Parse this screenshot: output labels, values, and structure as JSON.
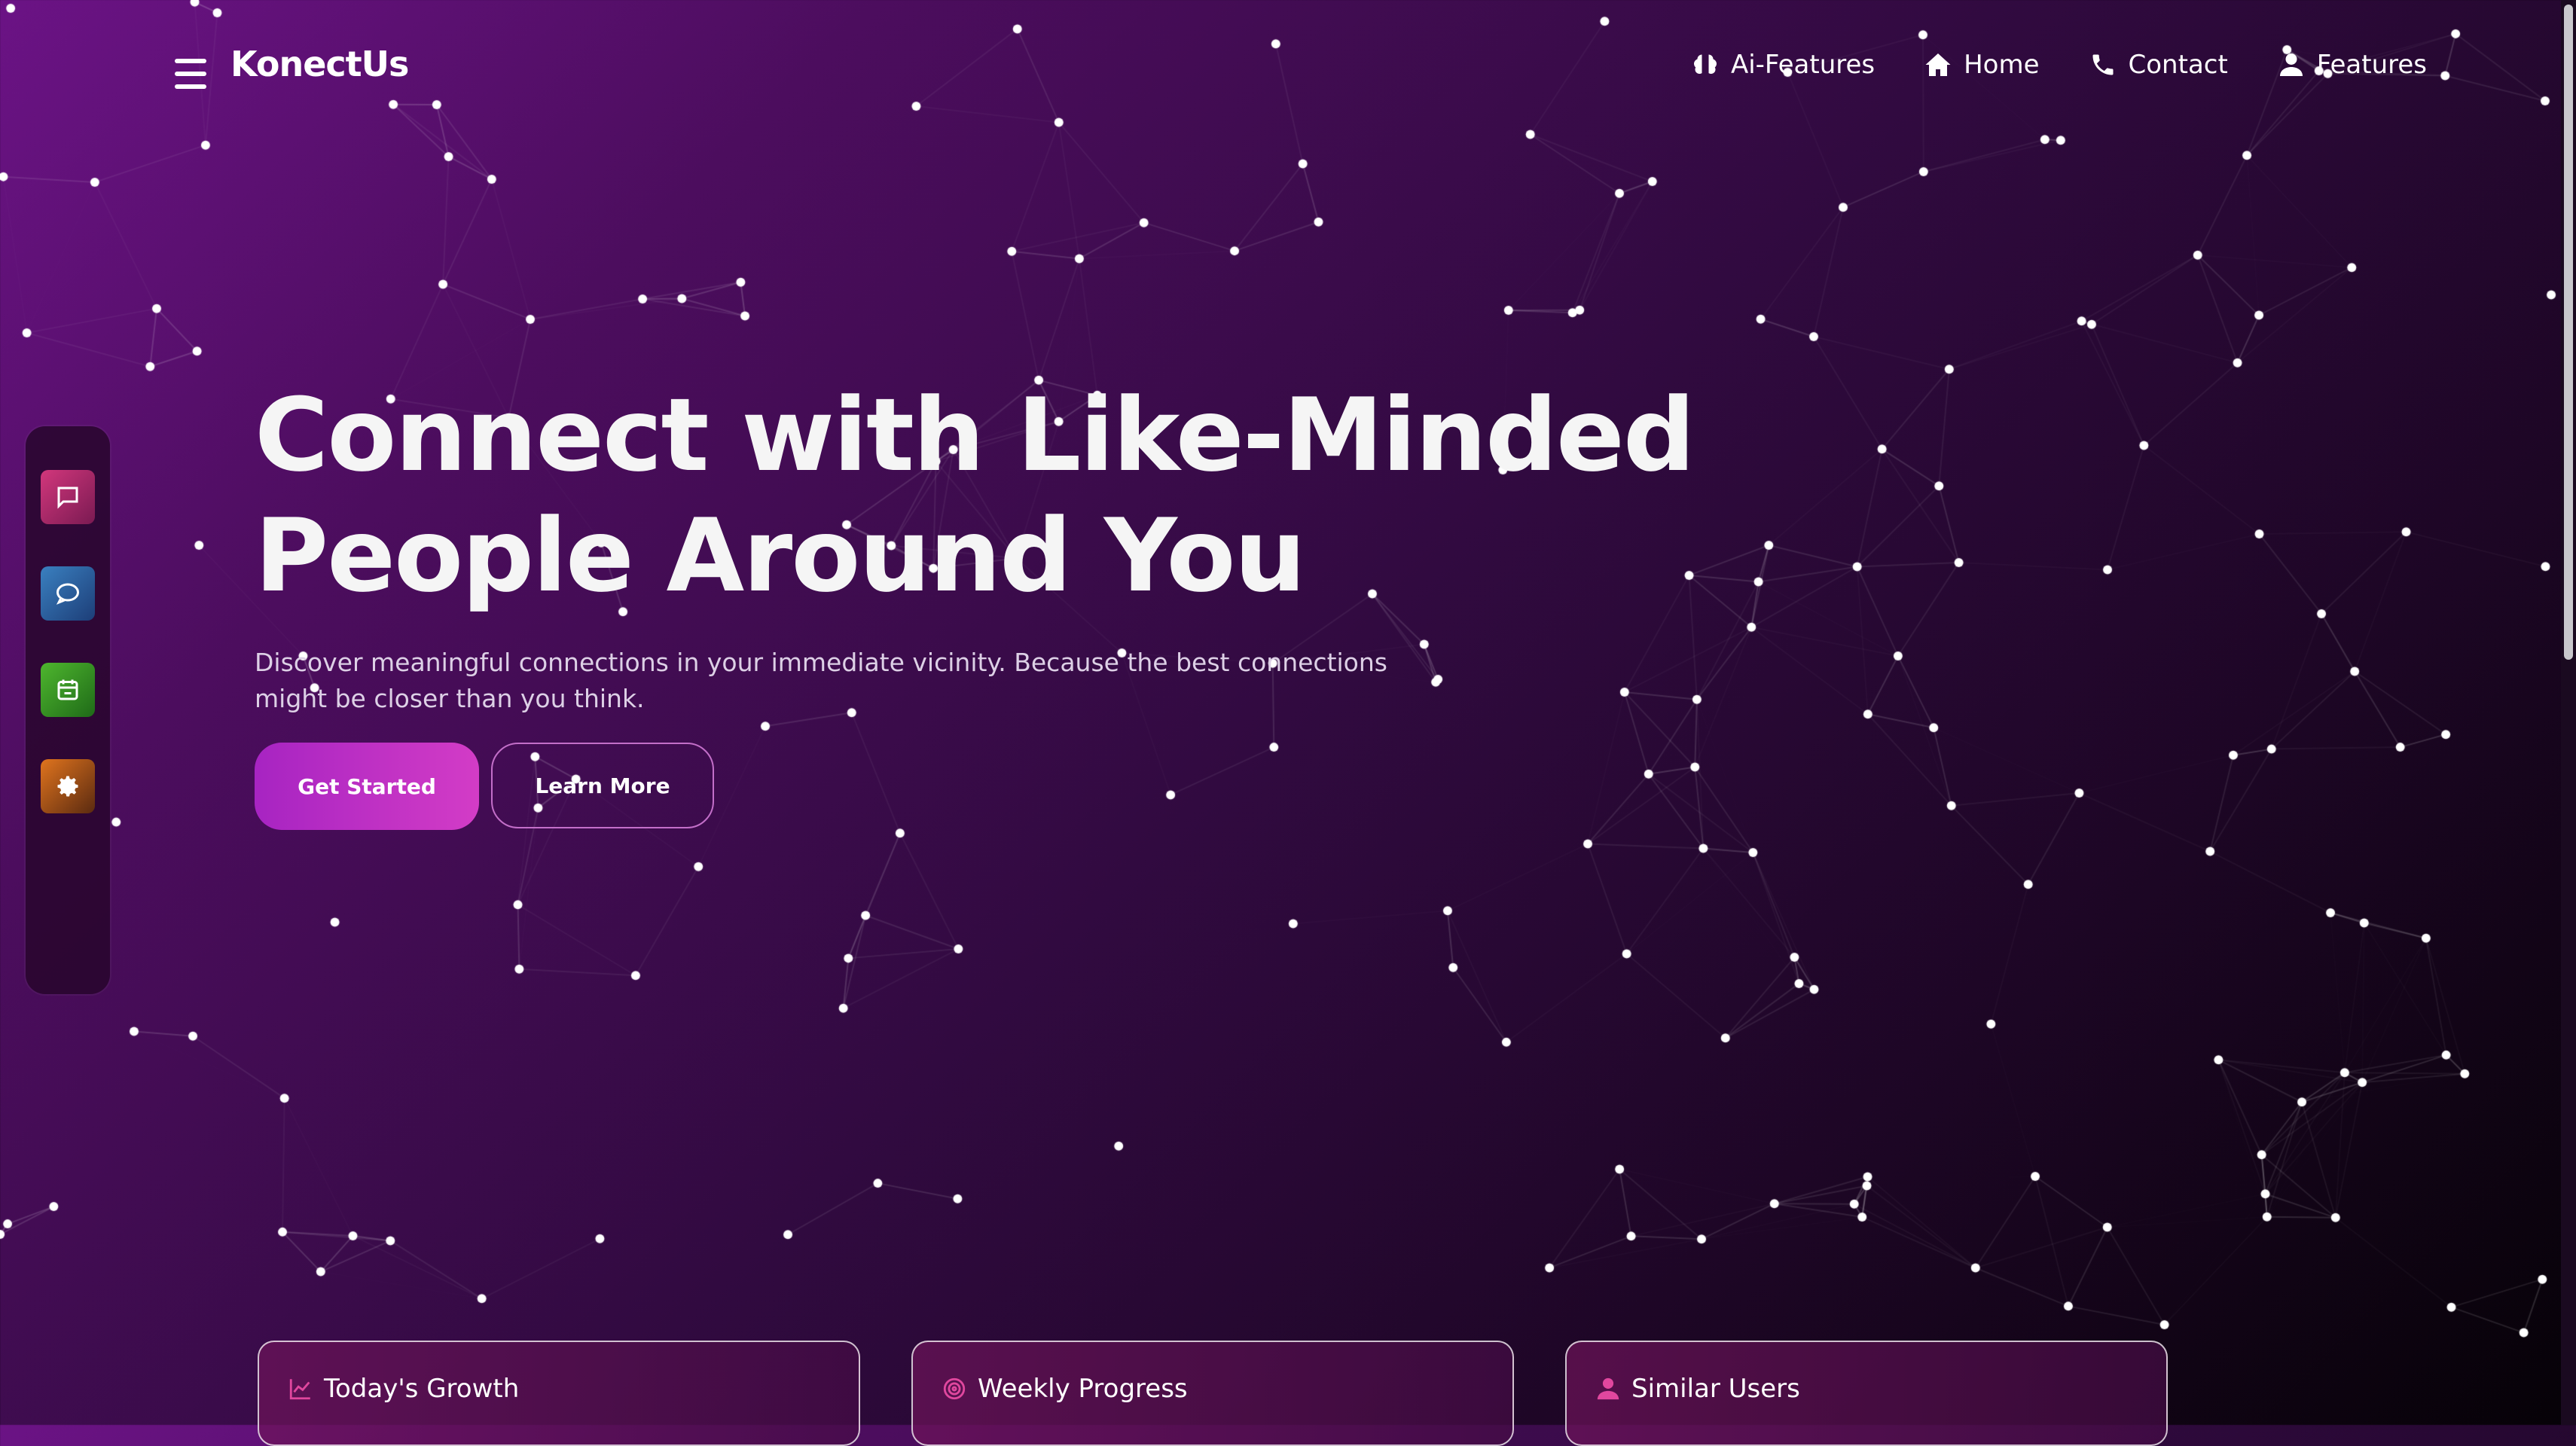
{
  "brand": {
    "name": "KonectUs"
  },
  "nav": {
    "links": [
      {
        "label": "Ai-Features",
        "icon": "brain-icon"
      },
      {
        "label": "Home",
        "icon": "home-icon"
      },
      {
        "label": "Contact",
        "icon": "phone-icon"
      },
      {
        "label": "Features",
        "icon": "user-icon"
      }
    ]
  },
  "side_dock": {
    "items": [
      {
        "icon": "message-square-icon",
        "color": "#c0306e"
      },
      {
        "icon": "chat-bubble-icon",
        "color": "#2a6aa8"
      },
      {
        "icon": "calendar-icon",
        "color": "#3a9a2a"
      },
      {
        "icon": "gear-icon",
        "color": "#d0641a"
      }
    ]
  },
  "hero": {
    "title_line1": "Connect with Like-Minded",
    "title_line2": "People Around You",
    "subtitle": "Discover meaningful connections in your immediate vicinity. Because the best connections might be closer than you think.",
    "primary_button": "Get Started",
    "secondary_button": "Learn More"
  },
  "cards": [
    {
      "title": "Today's Growth",
      "icon": "chart-line-icon"
    },
    {
      "title": "Weekly Progress",
      "icon": "target-icon"
    },
    {
      "title": "Similar Users",
      "icon": "user-icon"
    }
  ],
  "colors": {
    "accent": "#c02fc4",
    "accent_pink": "#e0479e",
    "background_dark": "#060207",
    "background_purple": "#6b1385"
  }
}
